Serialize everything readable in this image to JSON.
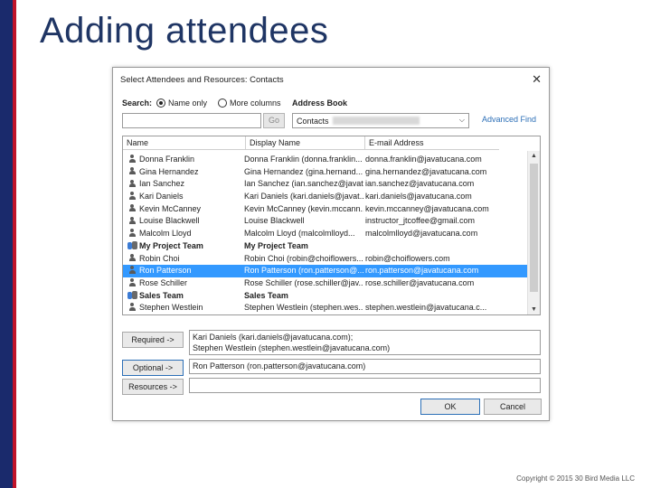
{
  "slide": {
    "title": "Adding attendees",
    "copyright": "Copyright © 2015 30 Bird Media LLC"
  },
  "dialog": {
    "title": "Select Attendees and Resources: Contacts",
    "close_glyph": "✕",
    "search_label": "Search:",
    "radio_name_only": "Name only",
    "radio_more_columns": "More columns",
    "address_book_label": "Address Book",
    "search_value": "",
    "go_label": "Go",
    "address_book_value": "Contacts",
    "chevron_glyph": "⌵",
    "advanced_find": "Advanced Find",
    "columns": {
      "name": "Name",
      "display_name": "Display Name",
      "email": "E-mail Address"
    },
    "rows": [
      {
        "type": "person",
        "name": "Donna Franklin",
        "display": "Donna Franklin (donna.franklin...",
        "email": "donna.franklin@javatucana.com"
      },
      {
        "type": "person",
        "name": "Gina Hernandez",
        "display": "Gina Hernandez (gina.hernand...",
        "email": "gina.hernandez@javatucana.com"
      },
      {
        "type": "person",
        "name": "Ian Sanchez",
        "display": "Ian Sanchez (ian.sanchez@javat...",
        "email": "ian.sanchez@javatucana.com"
      },
      {
        "type": "person",
        "name": "Kari Daniels",
        "display": "Kari Daniels (kari.daniels@javat...",
        "email": "kari.daniels@javatucana.com"
      },
      {
        "type": "person",
        "name": "Kevin McCanney",
        "display": "Kevin McCanney (kevin.mccann...",
        "email": "kevin.mccanney@javatucana.com"
      },
      {
        "type": "person",
        "name": "Louise Blackwell",
        "display": "Louise Blackwell",
        "email": "instructor_jtcoffee@gmail.com"
      },
      {
        "type": "person",
        "name": "Malcolm Lloyd",
        "display": "Malcolm Lloyd (malcolmlloyd...",
        "email": "malcolmlloyd@javatucana.com"
      },
      {
        "type": "group",
        "name": "My Project Team",
        "display": "My Project Team",
        "email": ""
      },
      {
        "type": "person",
        "name": "Robin Choi",
        "display": "Robin Choi (robin@choiflowers...",
        "email": "robin@choiflowers.com"
      },
      {
        "type": "person",
        "name": "Ron Patterson",
        "display": "Ron Patterson (ron.patterson@...",
        "email": "ron.patterson@javatucana.com",
        "selected": true
      },
      {
        "type": "person",
        "name": "Rose Schiller",
        "display": "Rose Schiller (rose.schiller@jav...",
        "email": "rose.schiller@javatucana.com"
      },
      {
        "type": "group",
        "name": "Sales Team",
        "display": "Sales Team",
        "email": ""
      },
      {
        "type": "person",
        "name": "Stephen Westlein",
        "display": "Stephen Westlein (stephen.wes...",
        "email": "stephen.westlein@javatucana.c..."
      }
    ],
    "scroll_up_glyph": "▲",
    "scroll_down_glyph": "▼",
    "required_label": "Required ->",
    "required_line1": "Kari Daniels (kari.daniels@javatucana.com);",
    "required_line2": "Stephen Westlein (stephen.westlein@javatucana.com)",
    "optional_label": "Optional ->",
    "optional_value": "Ron Patterson (ron.patterson@javatucana.com)",
    "resources_label": "Resources ->",
    "resources_value": "",
    "ok_label": "OK",
    "cancel_label": "Cancel"
  }
}
